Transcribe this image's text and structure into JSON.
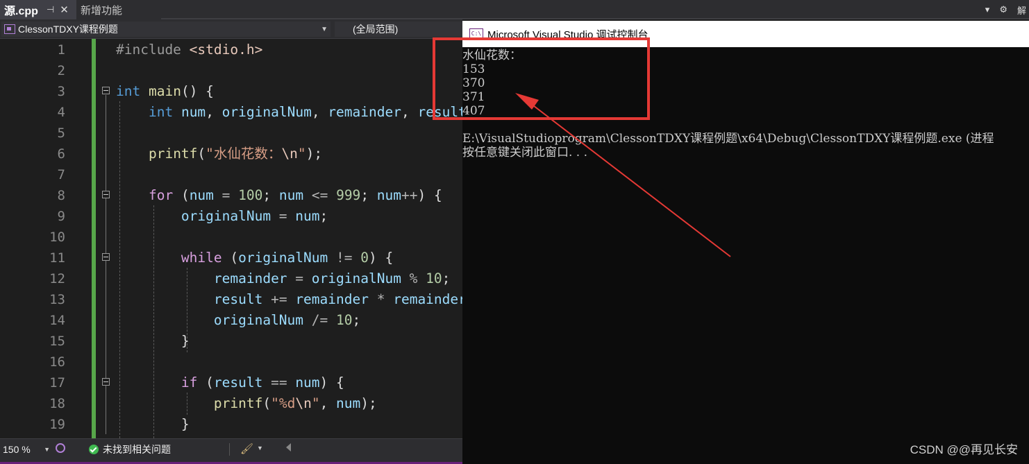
{
  "tabs": {
    "active": {
      "name": "源.cpp",
      "pin": "⊣",
      "close": "✕"
    },
    "inactive": {
      "name": "新增功能"
    },
    "right_icons": {
      "dropdown": "▾",
      "settings": "⚙",
      "overflow": "解"
    }
  },
  "navbar": {
    "project": "ClessonTDXY课程例题",
    "scope": "(全局范围)"
  },
  "editor": {
    "line_numbers": [
      "1",
      "2",
      "3",
      "4",
      "5",
      "6",
      "7",
      "8",
      "9",
      "10",
      "11",
      "12",
      "13",
      "14",
      "15",
      "16",
      "17",
      "18",
      "19"
    ],
    "lines": [
      [
        [
          "pp",
          "#include "
        ],
        [
          "inc",
          "<stdio.h>"
        ]
      ],
      [],
      [
        [
          "kw",
          "int"
        ],
        [
          "pl",
          " "
        ],
        [
          "fn",
          "main"
        ],
        [
          "pl",
          "() {"
        ]
      ],
      [
        [
          "pl",
          "    "
        ],
        [
          "kw",
          "int"
        ],
        [
          "pl",
          " "
        ],
        [
          "var",
          "num"
        ],
        [
          "pl",
          ", "
        ],
        [
          "var",
          "originalNum"
        ],
        [
          "pl",
          ", "
        ],
        [
          "var",
          "remainder"
        ],
        [
          "pl",
          ", "
        ],
        [
          "var",
          "result"
        ]
      ],
      [],
      [
        [
          "pl",
          "    "
        ],
        [
          "fn",
          "printf"
        ],
        [
          "pl",
          "("
        ],
        [
          "str",
          "\"水仙花数："
        ],
        [
          "esc",
          "\\n"
        ],
        [
          "str",
          "\""
        ],
        [
          "pl",
          ");"
        ]
      ],
      [],
      [
        [
          "pl",
          "    "
        ],
        [
          "ctl",
          "for"
        ],
        [
          "pl",
          " ("
        ],
        [
          "var",
          "num"
        ],
        [
          "op",
          " = "
        ],
        [
          "num",
          "100"
        ],
        [
          "pl",
          "; "
        ],
        [
          "var",
          "num"
        ],
        [
          "op",
          " <= "
        ],
        [
          "num",
          "999"
        ],
        [
          "pl",
          "; "
        ],
        [
          "var",
          "num"
        ],
        [
          "op",
          "++"
        ],
        [
          "pl",
          ") {"
        ]
      ],
      [
        [
          "pl",
          "        "
        ],
        [
          "var",
          "originalNum"
        ],
        [
          "op",
          " = "
        ],
        [
          "var",
          "num"
        ],
        [
          "pl",
          ";"
        ]
      ],
      [],
      [
        [
          "pl",
          "        "
        ],
        [
          "ctl",
          "while"
        ],
        [
          "pl",
          " ("
        ],
        [
          "var",
          "originalNum"
        ],
        [
          "op",
          " != "
        ],
        [
          "num",
          "0"
        ],
        [
          "pl",
          ") {"
        ]
      ],
      [
        [
          "pl",
          "            "
        ],
        [
          "var",
          "remainder"
        ],
        [
          "op",
          " = "
        ],
        [
          "var",
          "originalNum"
        ],
        [
          "op",
          " % "
        ],
        [
          "num",
          "10"
        ],
        [
          "pl",
          ";"
        ]
      ],
      [
        [
          "pl",
          "            "
        ],
        [
          "var",
          "result"
        ],
        [
          "op",
          " += "
        ],
        [
          "var",
          "remainder"
        ],
        [
          "op",
          " * "
        ],
        [
          "var",
          "remainder"
        ]
      ],
      [
        [
          "pl",
          "            "
        ],
        [
          "var",
          "originalNum"
        ],
        [
          "op",
          " /= "
        ],
        [
          "num",
          "10"
        ],
        [
          "pl",
          ";"
        ]
      ],
      [
        [
          "pl",
          "        }"
        ]
      ],
      [],
      [
        [
          "pl",
          "        "
        ],
        [
          "ctl",
          "if"
        ],
        [
          "pl",
          " ("
        ],
        [
          "var",
          "result"
        ],
        [
          "op",
          " == "
        ],
        [
          "var",
          "num"
        ],
        [
          "pl",
          ") {"
        ]
      ],
      [
        [
          "pl",
          "            "
        ],
        [
          "fn",
          "printf"
        ],
        [
          "pl",
          "("
        ],
        [
          "str",
          "\"%d"
        ],
        [
          "esc",
          "\\n"
        ],
        [
          "str",
          "\""
        ],
        [
          "pl",
          ", "
        ],
        [
          "var",
          "num"
        ],
        [
          "pl",
          ");"
        ]
      ],
      [
        [
          "pl",
          "        }"
        ]
      ]
    ]
  },
  "statusbar": {
    "zoom": "150 %",
    "issues": "未找到相关问题"
  },
  "console": {
    "title": "Microsoft Visual Studio 调试控制台",
    "lines": [
      "水仙花数：",
      "153",
      "370",
      "371",
      "407",
      "",
      "E:\\VisualStudioprogram\\ClessonTDXY课程例题\\x64\\Debug\\ClessonTDXY课程例题.exe (进程",
      "按任意键关闭此窗口. . ."
    ],
    "watermark": "CSDN @@再见长安"
  },
  "colors": {
    "highlight_box": "#e53935",
    "arrow": "#e53935",
    "change_bar": "#57a64a",
    "keyword": "#569cd6",
    "control": "#d8a0df",
    "number": "#b5cea8",
    "string": "#d69d85",
    "function": "#dcdcaa",
    "variable": "#9cdcfe"
  }
}
